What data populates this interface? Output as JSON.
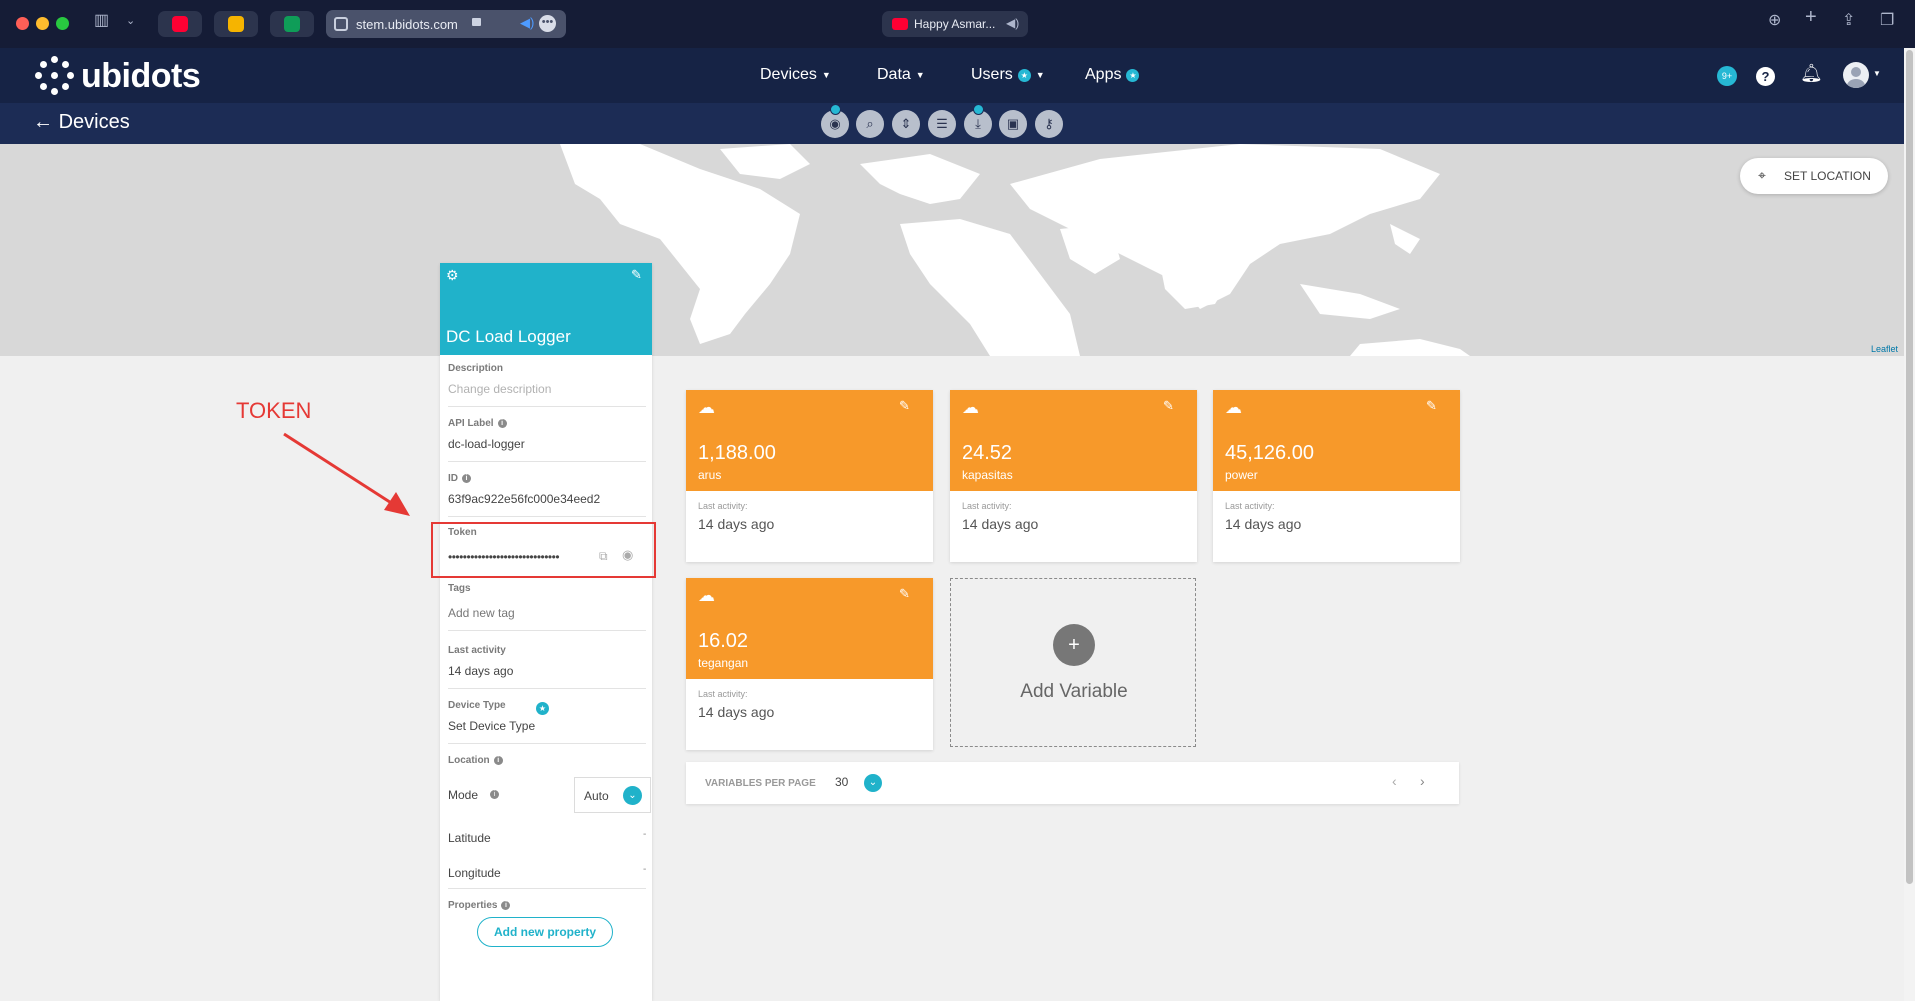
{
  "browser": {
    "url": "stem.ubidots.com",
    "media_tab_title": "Happy Asmar..."
  },
  "app": {
    "logo": "ubidots",
    "nav": {
      "devices": "Devices",
      "data": "Data",
      "users": "Users",
      "apps": "Apps"
    },
    "notifications_badge": "9+",
    "accent_color": "#20b2ca",
    "variable_color": "#f7992a"
  },
  "subheader": {
    "back_label": "Devices",
    "toolbar_icons": [
      "settings-icon",
      "search-icon",
      "sort-icon",
      "list-icon",
      "export-icon",
      "delete-icon",
      "key-icon"
    ]
  },
  "map": {
    "set_location": "SET LOCATION",
    "attribution": "Leaflet"
  },
  "annotation": {
    "label": "TOKEN"
  },
  "device": {
    "name": "DC Load Logger",
    "description_label": "Description",
    "description_placeholder": "Change description",
    "api_label_label": "API Label",
    "api_label": "dc-load-logger",
    "id_label": "ID",
    "id": "63f9ac922e56fc000e34eed2",
    "token_label": "Token",
    "token_masked": "••••••••••••••••••••••••••••••",
    "tags_label": "Tags",
    "tags_placeholder": "Add new tag",
    "last_activity_label": "Last activity",
    "last_activity": "14 days ago",
    "device_type_label": "Device Type",
    "device_type": "Set Device Type",
    "location_label": "Location",
    "mode_label": "Mode",
    "mode_value": "Auto",
    "latitude_label": "Latitude",
    "latitude_value": "-",
    "longitude_label": "Longitude",
    "longitude_value": "-",
    "properties_label": "Properties",
    "add_property": "Add new property"
  },
  "variables": [
    {
      "value": "1,188.00",
      "name": "arus",
      "last_activity_label": "Last activity:",
      "last_activity": "14 days ago"
    },
    {
      "value": "24.52",
      "name": "kapasitas",
      "last_activity_label": "Last activity:",
      "last_activity": "14 days ago"
    },
    {
      "value": "45,126.00",
      "name": "power",
      "last_activity_label": "Last activity:",
      "last_activity": "14 days ago"
    },
    {
      "value": "16.02",
      "name": "tegangan",
      "last_activity_label": "Last activity:",
      "last_activity": "14 days ago"
    }
  ],
  "add_variable": "Add Variable",
  "pagination": {
    "label": "VARIABLES PER PAGE",
    "per_page": "30"
  }
}
